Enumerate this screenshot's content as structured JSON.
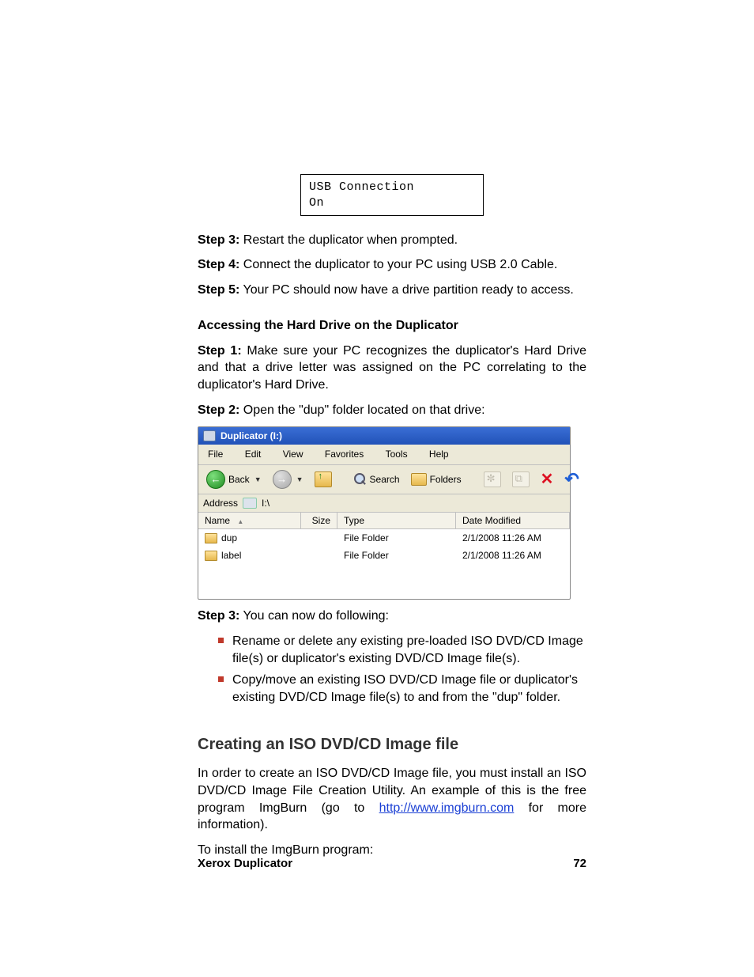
{
  "lcd": {
    "line1": "USB Connection",
    "line2": "On"
  },
  "steps_top": {
    "s3_label": "Step 3:",
    "s3_text": "Restart the duplicator when prompted.",
    "s4_label": "Step 4:",
    "s4_text": "Connect the duplicator to your PC using USB 2.0 Cable.",
    "s5_label": "Step 5:",
    "s5_text": "Your PC should now have a drive partition ready to access."
  },
  "subheading1": "Accessing the Hard Drive on the Duplicator",
  "steps_access": {
    "s1_label": "Step 1:",
    "s1_text": "Make sure your PC recognizes the duplicator's Hard Drive and that a drive letter was assigned on the PC correlating to the duplicator's Hard Drive.",
    "s2_label": "Step 2:",
    "s2_text": "Open the \"dup\" folder located on that drive:",
    "s3_label": "Step 3:",
    "s3_text": "You can now do following:"
  },
  "bullets": {
    "b1": "Rename or delete any existing pre-loaded ISO DVD/CD Image file(s) or duplicator's existing DVD/CD Image file(s).",
    "b2": "Copy/move an existing ISO DVD/CD Image file or duplicator's existing DVD/CD Image file(s) to and from the \"dup\" folder."
  },
  "heading2": "Creating an ISO DVD/CD Image file",
  "iso_para_pre": "In order to create an ISO DVD/CD Image file, you must install an ISO DVD/CD Image File Creation Utility. An example of this is the free program ImgBurn (go to ",
  "iso_link_text": "http://www.imgburn.com",
  "iso_link_href": "http://www.imgburn.com",
  "iso_para_post": " for more information).",
  "install_line": "To install the ImgBurn program:",
  "explorer": {
    "title": "Duplicator (I:)",
    "menus": {
      "file": "File",
      "edit": "Edit",
      "view": "View",
      "favorites": "Favorites",
      "tools": "Tools",
      "help": "Help"
    },
    "toolbar": {
      "back": "Back",
      "search": "Search",
      "folders": "Folders"
    },
    "address_label": "Address",
    "address_value": "I:\\",
    "cols": {
      "name": "Name",
      "size": "Size",
      "type": "Type",
      "date": "Date Modified"
    },
    "rows": [
      {
        "name": "dup",
        "type": "File Folder",
        "date": "2/1/2008 11:26 AM"
      },
      {
        "name": "label",
        "type": "File Folder",
        "date": "2/1/2008 11:26 AM"
      }
    ]
  },
  "footer": {
    "left": "Xerox Duplicator",
    "right": "72"
  }
}
